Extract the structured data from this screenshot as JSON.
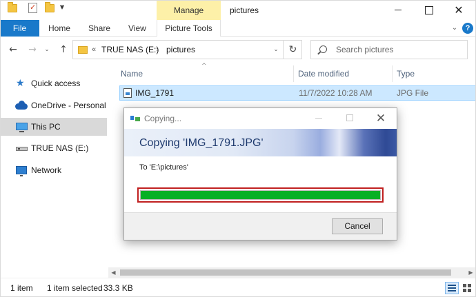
{
  "window": {
    "title": "pictures",
    "context_tab": "Manage",
    "buttons": [
      "minimize",
      "maximize",
      "close"
    ]
  },
  "ribbon": {
    "file": "File",
    "tabs": [
      "Home",
      "Share",
      "View",
      "Picture Tools"
    ]
  },
  "address": {
    "overflow": "«",
    "crumbs": [
      "TRUE NAS (E:)",
      "pictures"
    ],
    "separator": "›",
    "refresh": "↻"
  },
  "search": {
    "placeholder": "Search pictures"
  },
  "nav": {
    "back": "←",
    "forward": "→",
    "recent": "⌄",
    "up": "↑",
    "items": [
      {
        "label": "Quick access",
        "icon": "star-icon"
      },
      {
        "label": "OneDrive - Personal",
        "icon": "cloud-icon"
      },
      {
        "label": "This PC",
        "icon": "computer-icon",
        "selected": true
      },
      {
        "label": "TRUE NAS (E:)",
        "icon": "drive-icon"
      },
      {
        "label": "Network",
        "icon": "network-icon"
      }
    ]
  },
  "columns": {
    "name": "Name",
    "date": "Date modified",
    "type": "Type"
  },
  "files": [
    {
      "name": "IMG_1791",
      "date": "11/7/2022 10:28 AM",
      "type": "JPG File",
      "selected": true
    }
  ],
  "status": {
    "count": "1 item",
    "selected": "1 item selected",
    "size": "33.3 KB"
  },
  "dialog": {
    "title": "Copying...",
    "heading": "Copying 'IMG_1791.JPG'",
    "destination": "To 'E:\\pictures'",
    "progress_percent": 100,
    "cancel": "Cancel",
    "close": "✕"
  },
  "colors": {
    "accent": "#1979ca",
    "manage_tab": "#fdf0a8",
    "selection": "#cce8ff",
    "progress": "#06b025",
    "highlight_outline": "#c01f1f"
  }
}
